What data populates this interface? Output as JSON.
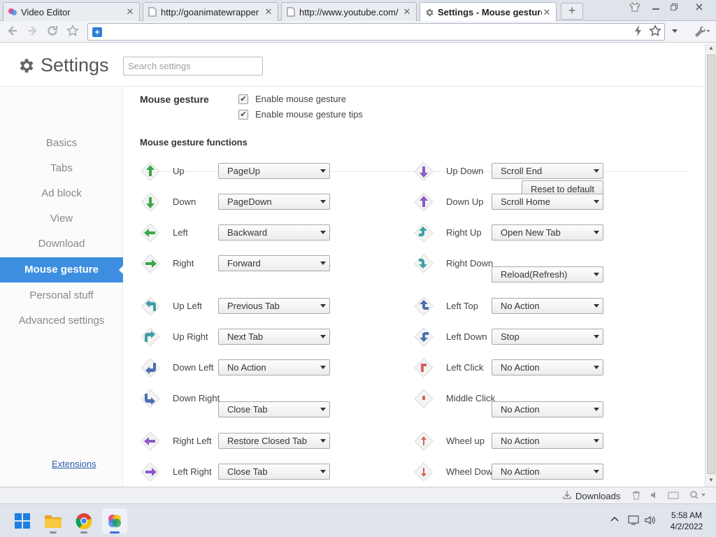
{
  "browser": {
    "tabs": [
      {
        "title": "Video Editor",
        "active": false
      },
      {
        "title": "http://goanimatewrapper",
        "active": false
      },
      {
        "title": "http://www.youtube.com/",
        "active": false
      },
      {
        "title": "Settings - Mouse gesture",
        "active": true
      }
    ],
    "new_tab_symbol": "+",
    "window_buttons": [
      "shirt-icon",
      "minimize-icon",
      "restore-icon",
      "close-icon"
    ],
    "omnibox_value": ""
  },
  "settings": {
    "title": "Settings",
    "search_placeholder": "Search settings",
    "nav": [
      {
        "label": "Basics",
        "active": false
      },
      {
        "label": "Tabs",
        "active": false
      },
      {
        "label": "Ad block",
        "active": false
      },
      {
        "label": "View",
        "active": false
      },
      {
        "label": "Download",
        "active": false
      },
      {
        "label": "Mouse gesture",
        "active": true
      },
      {
        "label": "Personal stuff",
        "active": false
      },
      {
        "label": "Advanced settings",
        "active": false
      }
    ],
    "extensions_link": "Extensions",
    "mouse_gesture": {
      "section_label": "Mouse gesture",
      "enable_label": "Enable mouse gesture",
      "enable_checked": true,
      "tips_label": "Enable mouse gesture tips",
      "tips_checked": true
    },
    "functions": {
      "section_label": "Mouse gesture functions",
      "reset_label": "Reset to default",
      "left_column": [
        {
          "gesture": "Up",
          "action": "PageUp",
          "icon": "arrow-up-icon"
        },
        {
          "gesture": "Down",
          "action": "PageDown",
          "icon": "arrow-down-icon"
        },
        {
          "gesture": "Left",
          "action": "Backward",
          "icon": "arrow-left-icon"
        },
        {
          "gesture": "Right",
          "action": "Forward",
          "icon": "arrow-right-icon"
        },
        {
          "gesture": "Up Left",
          "action": "Previous Tab",
          "icon": "arrow-up-left-icon"
        },
        {
          "gesture": "Up Right",
          "action": "Next Tab",
          "icon": "arrow-up-right-icon"
        },
        {
          "gesture": "Down Left",
          "action": "No Action",
          "icon": "arrow-down-left-icon"
        },
        {
          "gesture": "Down Right",
          "action": "Close Tab",
          "icon": "arrow-down-right-icon"
        },
        {
          "gesture": "Right Left",
          "action": "Restore Closed Tab",
          "icon": "arrow-right-left-icon"
        },
        {
          "gesture": "Left Right",
          "action": "Close Tab",
          "icon": "arrow-left-right-icon"
        }
      ],
      "right_column": [
        {
          "gesture": "Up Down",
          "action": "Scroll End",
          "icon": "arrow-up-down-icon"
        },
        {
          "gesture": "Down Up",
          "action": "Scroll Home",
          "icon": "arrow-down-up-icon"
        },
        {
          "gesture": "Right Up",
          "action": "Open New Tab",
          "icon": "arrow-right-up-icon"
        },
        {
          "gesture": "Right Down",
          "action": "Reload(Refresh)",
          "icon": "arrow-right-down-icon"
        },
        {
          "gesture": "Left Top",
          "action": "No Action",
          "icon": "arrow-left-top-icon"
        },
        {
          "gesture": "Left Down",
          "action": "Stop",
          "icon": "arrow-left-down-icon"
        },
        {
          "gesture": "Left Click",
          "action": "No Action",
          "icon": "left-click-icon"
        },
        {
          "gesture": "Middle Click",
          "action": "No Action",
          "icon": "middle-click-icon"
        },
        {
          "gesture": "Wheel up",
          "action": "No Action",
          "icon": "wheel-up-icon"
        },
        {
          "gesture": "Wheel Down",
          "action": "No Action",
          "icon": "wheel-down-icon"
        }
      ]
    }
  },
  "statusbar": {
    "downloads_label": "Downloads"
  },
  "taskbar": {
    "apps": [
      "windows-start-icon",
      "file-explorer-icon",
      "chrome-icon",
      "video-editor-icon"
    ],
    "time": "5:58 AM",
    "date": "4/2/2022"
  },
  "colors": {
    "accent": "#3d8ee0",
    "icon_green": "#39a84a",
    "icon_teal": "#3f9fa5",
    "icon_purple": "#8a5bc8",
    "icon_red": "#d86060"
  }
}
